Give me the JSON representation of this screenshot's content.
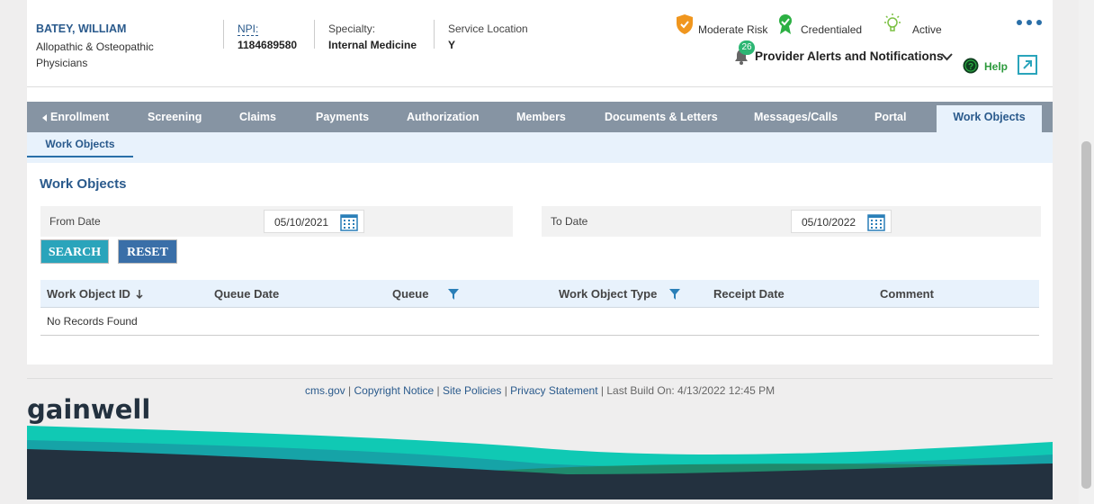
{
  "provider": {
    "name": "BATEY, WILLIAM",
    "type": "Allopathic & Osteopathic Physicians",
    "npi_label": "NPI:",
    "npi_value": "1184689580",
    "specialty_label": "Specialty:",
    "specialty_value": "Internal Medicine",
    "service_location_label": "Service Location",
    "service_location_value": "Y"
  },
  "status": {
    "risk": "Moderate Risk",
    "credential": "Credentialed",
    "active": "Active"
  },
  "alerts": {
    "count": "26",
    "label": "Provider Alerts and Notifications"
  },
  "help": {
    "label": "Help"
  },
  "tabs": [
    {
      "label": "Enrollment"
    },
    {
      "label": "Screening"
    },
    {
      "label": "Claims"
    },
    {
      "label": "Payments"
    },
    {
      "label": "Authorization"
    },
    {
      "label": "Members"
    },
    {
      "label": "Documents & Letters"
    },
    {
      "label": "Messages/Calls"
    },
    {
      "label": "Portal"
    },
    {
      "label": "Work Objects"
    }
  ],
  "subtabs": [
    {
      "label": "Work Objects"
    }
  ],
  "section_title": "Work Objects",
  "filters": {
    "from_label": "From Date",
    "from_value": "05/10/2021",
    "to_label": "To Date",
    "to_value": "05/10/2022"
  },
  "buttons": {
    "search": "SEARCH",
    "reset": "RESET"
  },
  "table": {
    "columns": [
      "Work Object ID",
      "Queue Date",
      "Queue",
      "Work Object Type",
      "Receipt Date",
      "Comment"
    ],
    "empty_message": "No Records Found"
  },
  "footer": {
    "links": [
      "cms.gov",
      "Copyright Notice",
      "Site Policies",
      "Privacy Statement"
    ],
    "last_build": "Last Build On: 4/13/2022 12:45 PM",
    "separator": " | "
  },
  "brand": {
    "logo_text": "gainwell"
  },
  "colors": {
    "header_blue": "#2a5a8c",
    "tab_bar": "#8694a3",
    "search_button": "#2aa4bb",
    "reset_button": "#3a6fa8",
    "help_green": "#2c9a3c"
  }
}
